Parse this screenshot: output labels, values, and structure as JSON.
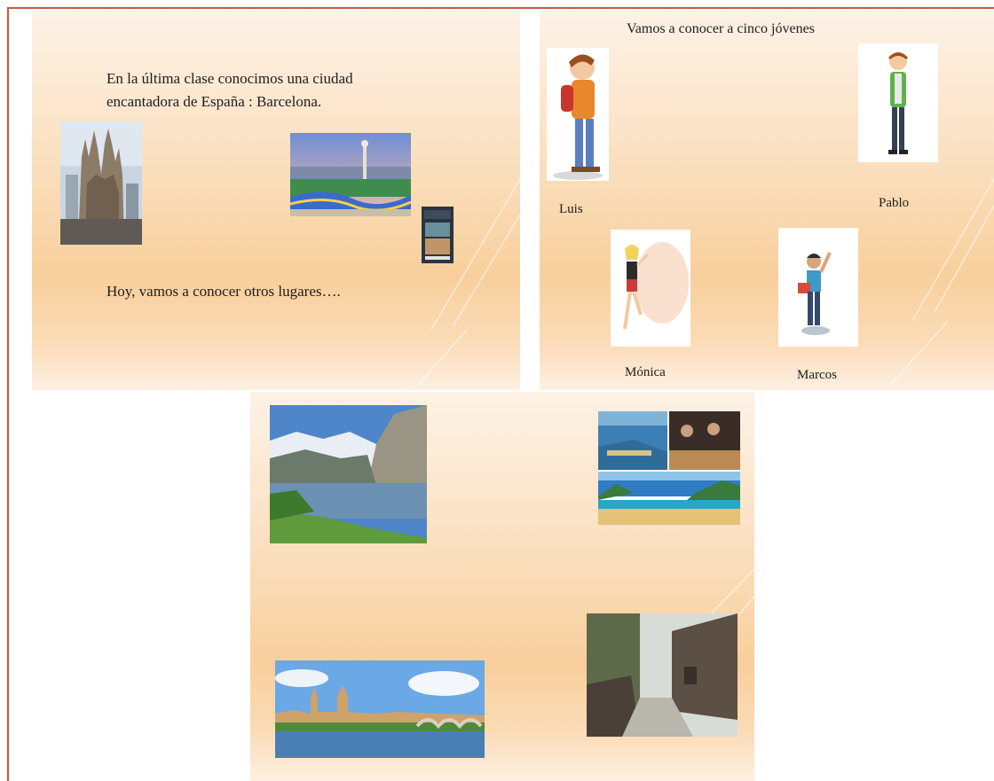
{
  "slide1": {
    "intro_line1": "En la última clase conocimos una ciudad",
    "intro_line2": "encantadora de España : Barcelona.",
    "outro": "Hoy, vamos a conocer otros lugares…."
  },
  "slide2": {
    "title": "Vamos a conocer a cinco jóvenes",
    "names": {
      "luis": "Luis",
      "pablo": "Pablo",
      "monica": "Mónica",
      "marcos": "Marcos"
    }
  },
  "colors": {
    "frame": "#c9573e",
    "slide_light": "#fdf2e6",
    "slide_peach": "#f8cf9c"
  },
  "icons": {
    "sagrada": "sagrada-familia-photo",
    "guell": "park-guell-photo",
    "book": "book-cover-photo",
    "luis": "boy-backpack-illustration",
    "pablo": "boy-standing-illustration",
    "monica": "girl-dancing-illustration",
    "marcos": "boy-waving-illustration",
    "mountains": "mountain-lake-photo",
    "collage": "san-sebastian-collage-photo",
    "salamanca": "salamanca-cathedral-river-photo",
    "village": "stone-village-street-photo"
  }
}
